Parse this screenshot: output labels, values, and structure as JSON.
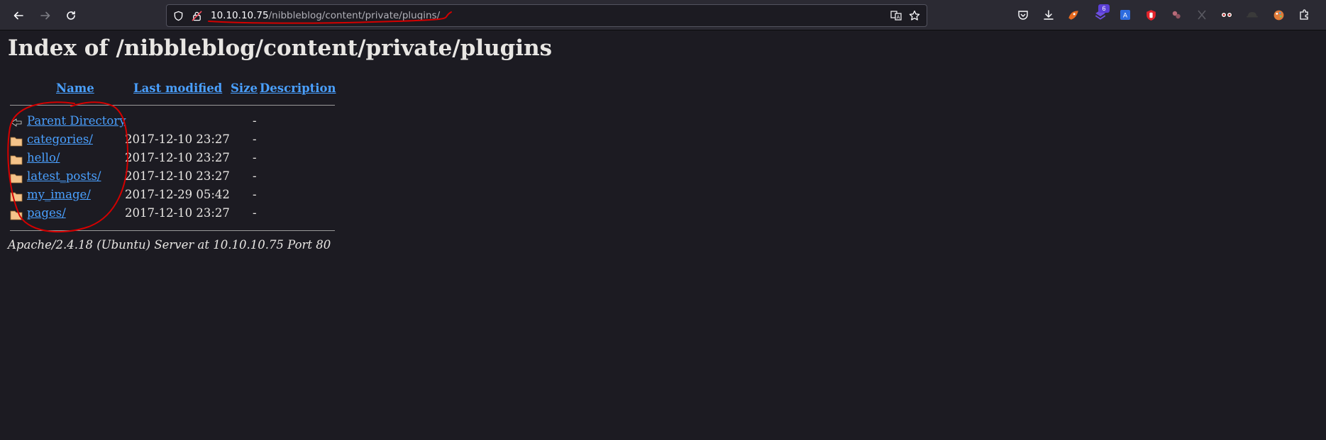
{
  "browser": {
    "url_host": "10.10.10.75",
    "url_path": "/nibbleblog/content/private/plugins/",
    "extension_badge": "6",
    "icons": {
      "back": "back-arrow-icon",
      "forward": "forward-arrow-icon",
      "reload": "reload-icon",
      "shield": "shield-icon",
      "lock": "insecure-lock-icon",
      "translate": "translate-icon",
      "bookmark": "star-icon",
      "pocket": "pocket-icon",
      "downloads": "download-icon",
      "extensions": "extensions-menu-icon"
    }
  },
  "page": {
    "title": "Index of /nibbleblog/content/private/plugins",
    "columns": {
      "name": "Name",
      "last_modified": "Last modified",
      "size": "Size",
      "description": "Description"
    },
    "parent": {
      "name": "Parent Directory",
      "size": "-"
    },
    "rows": [
      {
        "name": "categories/",
        "modified": "2017-12-10 23:27",
        "size": "-"
      },
      {
        "name": "hello/",
        "modified": "2017-12-10 23:27",
        "size": "-"
      },
      {
        "name": "latest_posts/",
        "modified": "2017-12-10 23:27",
        "size": "-"
      },
      {
        "name": "my_image/",
        "modified": "2017-12-29 05:42",
        "size": "-"
      },
      {
        "name": "pages/",
        "modified": "2017-12-10 23:27",
        "size": "-"
      }
    ],
    "footer": "Apache/2.4.18 (Ubuntu) Server at 10.10.10.75 Port 80"
  },
  "colors": {
    "link": "#4aa0ff",
    "annotation": "#d40000",
    "background": "#1c1b22",
    "toolbar": "#2b2a33"
  }
}
